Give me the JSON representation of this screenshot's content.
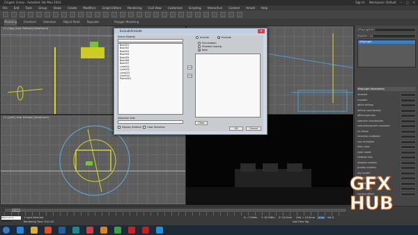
{
  "window": {
    "title": "Cingam 3.max - Autodesk 3ds Max 2014",
    "signin": "Sign In",
    "workspace": "Workspace: Default"
  },
  "menu": [
    "File",
    "Edit",
    "Tools",
    "Group",
    "Views",
    "Create",
    "Modifiers",
    "Graph Editors",
    "Rendering",
    "Civil View",
    "Customize",
    "Scripting",
    "Interactive",
    "Content",
    "Arnold",
    "Help"
  ],
  "ribbon": {
    "tabs": [
      "Modeling",
      "Freeform",
      "Selection",
      "Object Paint",
      "Populate"
    ],
    "sub": "Polygon Modeling"
  },
  "viewports": {
    "top_left": "[+] [Top] [User Defined] [Wireframe]",
    "bottom_left": "[+] [Left] [User Defined] [Wireframe]"
  },
  "dialog": {
    "title": "Exclude/Include",
    "scene_objects_label": "Scene Objects",
    "objects": [
      "Box001",
      "Box002",
      "Box003",
      "Box004",
      "Box005",
      "Box006",
      "Box007",
      "Line001",
      "Line002",
      "Line003",
      "Line004",
      "Plane001"
    ],
    "radio_include": "Include",
    "radio_exclude": "Exclude",
    "radio_illumination": "Illumination",
    "radio_shadow_casting": "Shadow Casting",
    "radio_both": "Both",
    "selection_sets_label": "Selection Sets",
    "display_subtree": "Display Subtree",
    "case_sensitive": "Case Sensitive",
    "clear_button": "Clear",
    "ok_button": "OK",
    "cancel_button": "Cancel",
    "move_right": ">>",
    "move_left": "<<"
  },
  "command_panel": {
    "name_field": "VRayLight001",
    "modifier_list": "Modifier List",
    "stack_item": "VRayLight",
    "rollout": "VRayLight Parameters",
    "params": [
      "enabled",
      "invisible",
      "affect diffuse",
      "diffuse contribution",
      "affect specular",
      "specular contribution",
      "cast atmospheric shadows",
      "no decay",
      "intensity multiplier",
      "size multiplier",
      "filter color",
      "color mode",
      "shadow bias",
      "shadow subdivs",
      "photon subdivs",
      "sky model",
      "indirect horiz illum",
      "ground albedo",
      "blend angle",
      "horizon offset"
    ]
  },
  "timeline": {
    "frame": "0 / 100"
  },
  "status": {
    "selection": "1 Light Selected",
    "render_time": "Rendering Time: 0:01:22",
    "maxscript": "Welcome to MAXScript",
    "add_time_tag": "Add Time Tag",
    "x": "X: -7.946m",
    "y": "Y: 16.346m",
    "z": "Z: 10.0mm",
    "grid": "Grid = 10.0mm",
    "auto": "Auto",
    "set_key": "Set K."
  },
  "watermark": {
    "line1": "GFX",
    "line2": "HUB"
  },
  "colors": {
    "accent_yellow": "#d8d820",
    "accent_blue": "#4aa0d8",
    "wire_green": "#7ac040"
  },
  "icons": [
    "windows-start-icon",
    "ie-icon",
    "explorer-icon",
    "media-icon",
    "photoshop-icon",
    "3dsmax-icon",
    "vray-icon",
    "illustrator-icon",
    "chrome-icon",
    "yandex-icon",
    "opera-icon",
    "skype-icon"
  ]
}
